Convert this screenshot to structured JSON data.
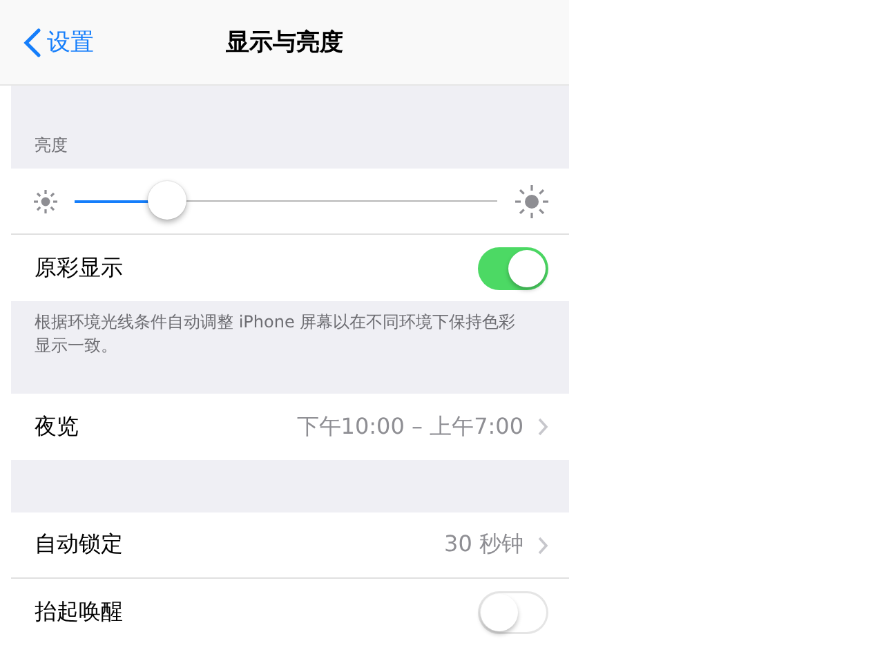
{
  "nav": {
    "back": "设置",
    "title": "显示与亮度"
  },
  "sections": [
    {
      "header": "亮度",
      "rows": [
        {
          "kind": "slider",
          "level": 0.22
        },
        {
          "kind": "toggle",
          "label": "原彩显示",
          "on": true
        }
      ],
      "footer": "根据环境光线条件自动调整 iPhone 屏幕以在不同环境下保持色彩显示一致。"
    },
    {
      "rows": [
        {
          "kind": "detail",
          "label": "夜览",
          "value": "下午10:00 – 上午7:00"
        }
      ]
    },
    {
      "rows": [
        {
          "kind": "detail",
          "label": "自动锁定",
          "value": "30 秒钟"
        },
        {
          "kind": "toggle",
          "label": "抬起唤醒",
          "on": false
        }
      ]
    }
  ]
}
